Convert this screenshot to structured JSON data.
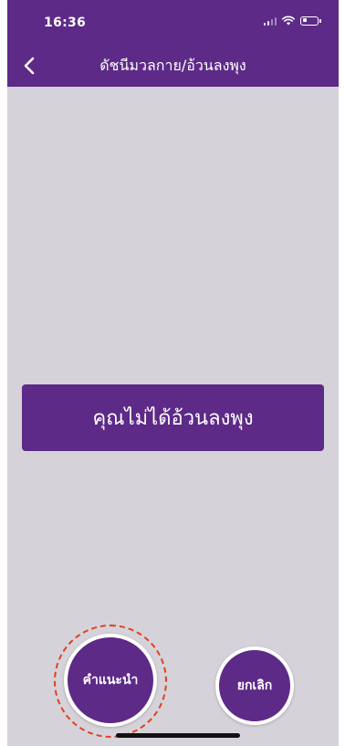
{
  "status_bar": {
    "time": "16:36",
    "icons": [
      "signal-icon",
      "wifi-icon",
      "battery-icon"
    ]
  },
  "header": {
    "title": "ดัชนีมวลกาย/อ้วนลงพุง",
    "back_icon": "chevron-left-icon"
  },
  "result": {
    "text": "คุณไม่ได้อ้วนลงพุง"
  },
  "actions": {
    "advice_label": "คำแนะนำ",
    "cancel_label": "ยกเลิก"
  },
  "colors": {
    "primary": "#5d2a87",
    "background": "#d6d2da",
    "highlight_ring": "#e0421d",
    "text_on_primary": "#ffffff"
  }
}
